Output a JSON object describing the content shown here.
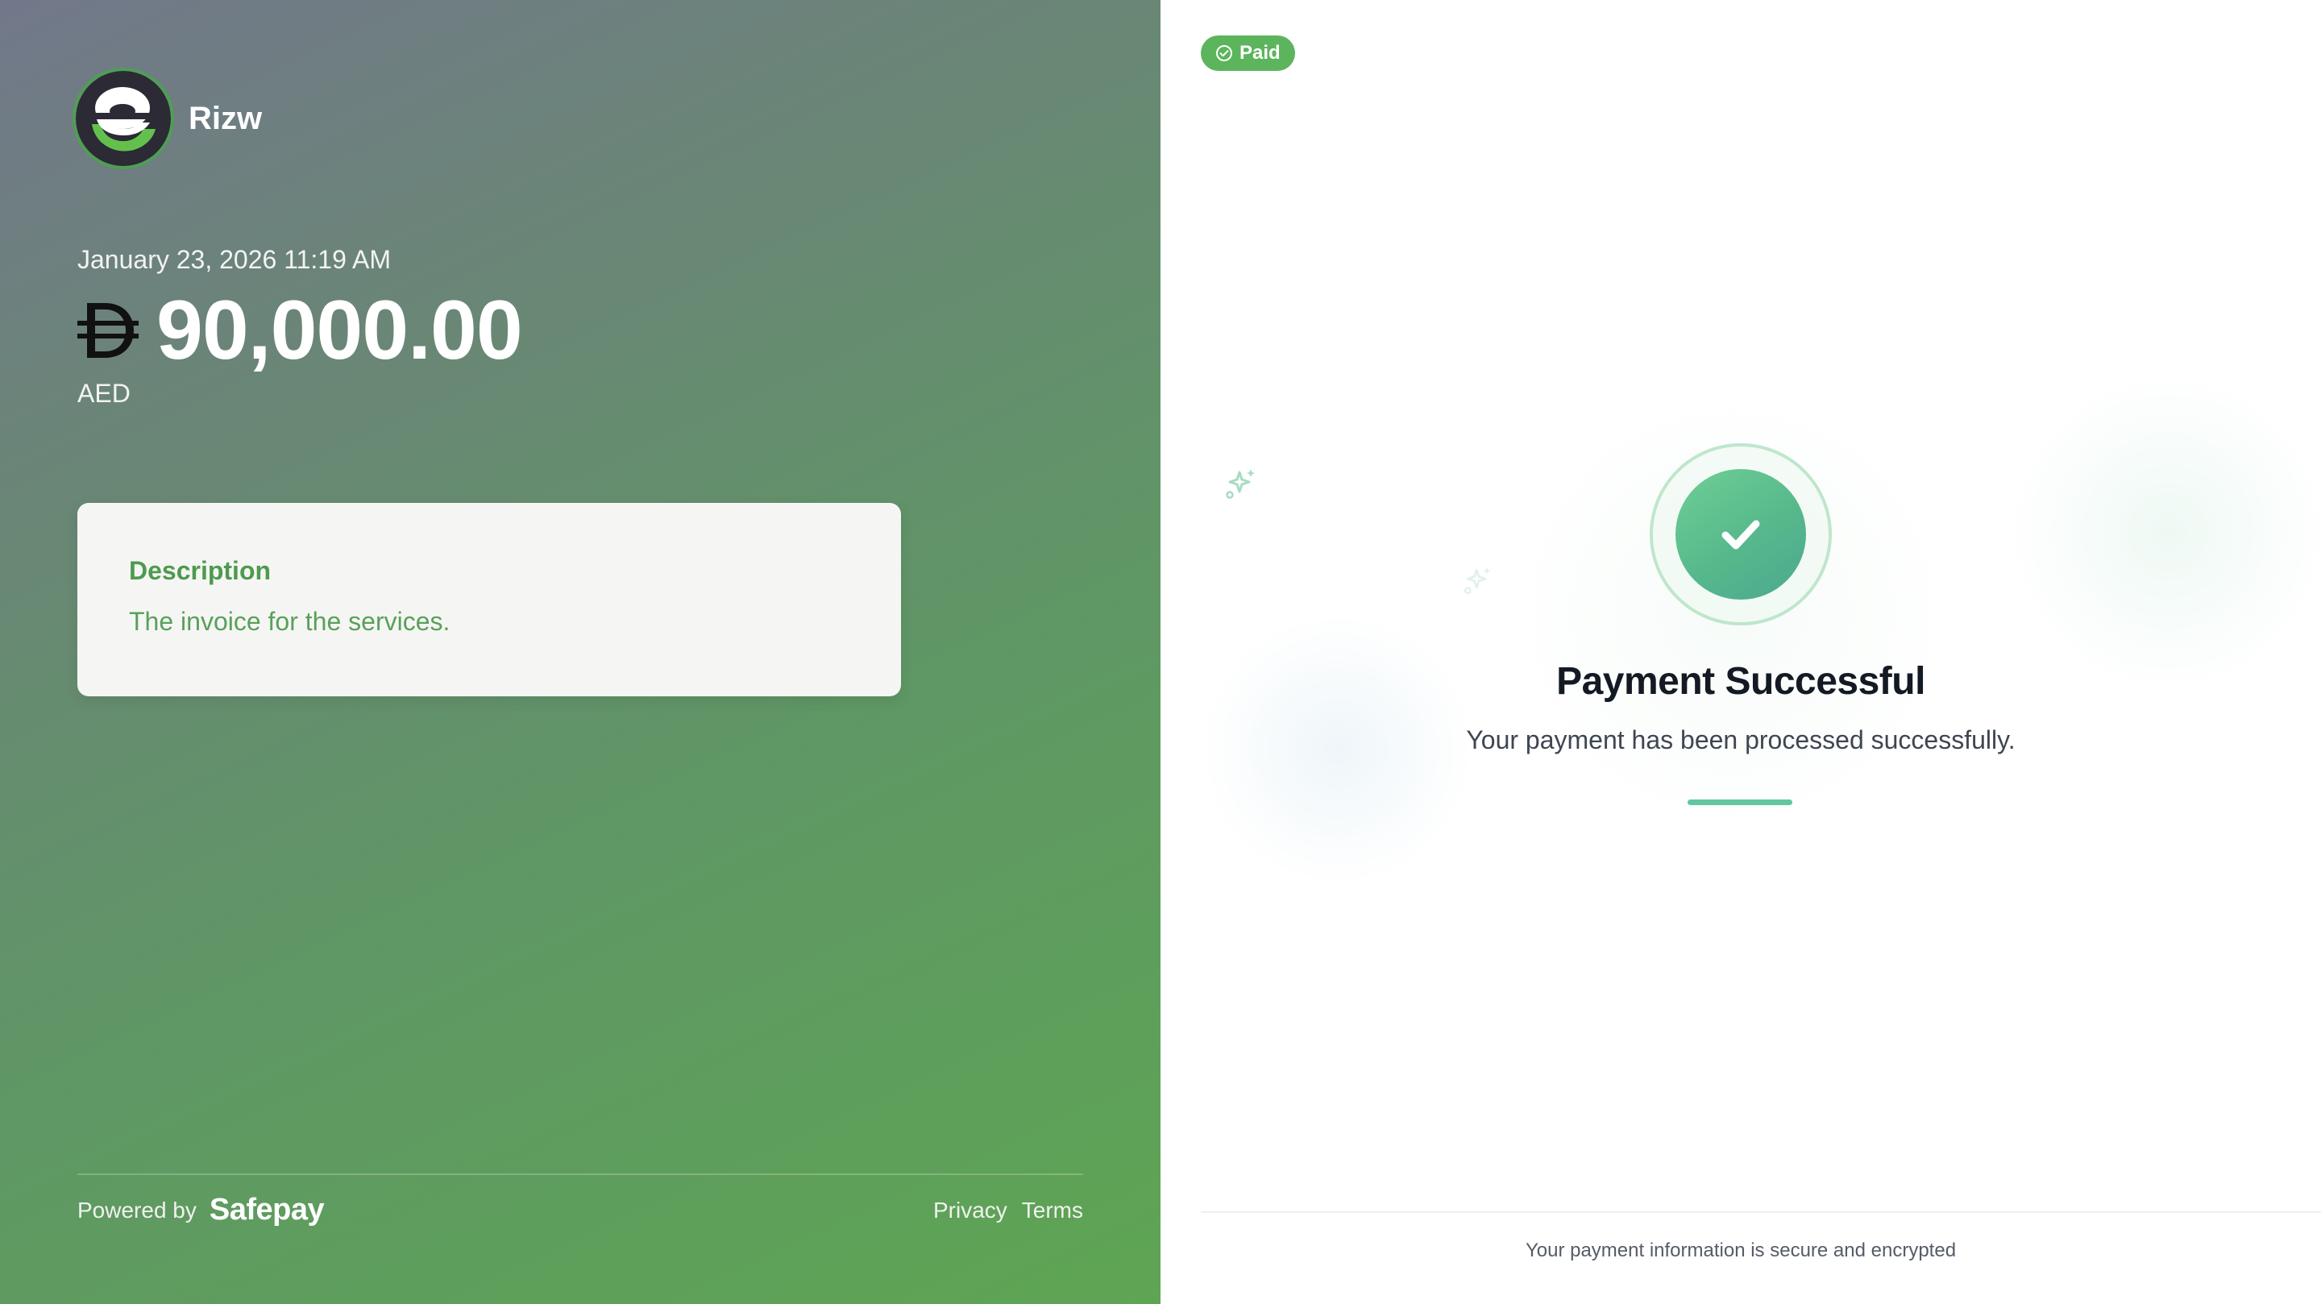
{
  "merchant": {
    "name": "Rizw",
    "logo_icon": "merchant-logo-icon"
  },
  "payment": {
    "date": "January 23, 2026 11:19 AM",
    "amount": "90,000.00",
    "currency_code": "AED",
    "currency_icon": "dirham-symbol-icon"
  },
  "description": {
    "title": "Description",
    "text": "The invoice for the services."
  },
  "footer": {
    "powered_by_label": "Powered by",
    "powered_by_brand": "Safepay",
    "links": {
      "privacy": "Privacy",
      "terms": "Terms"
    }
  },
  "status": {
    "badge": "Paid",
    "badge_icon": "check-circle-icon",
    "title": "Payment Successful",
    "subtitle": "Your payment has been processed successfully.",
    "success_icon": "checkmark-icon"
  },
  "security": {
    "note": "Your payment information is secure and encrypted"
  },
  "colors": {
    "accent_green": "#5cb55c",
    "success_teal": "#57b88c",
    "title_dark": "#141a24"
  }
}
